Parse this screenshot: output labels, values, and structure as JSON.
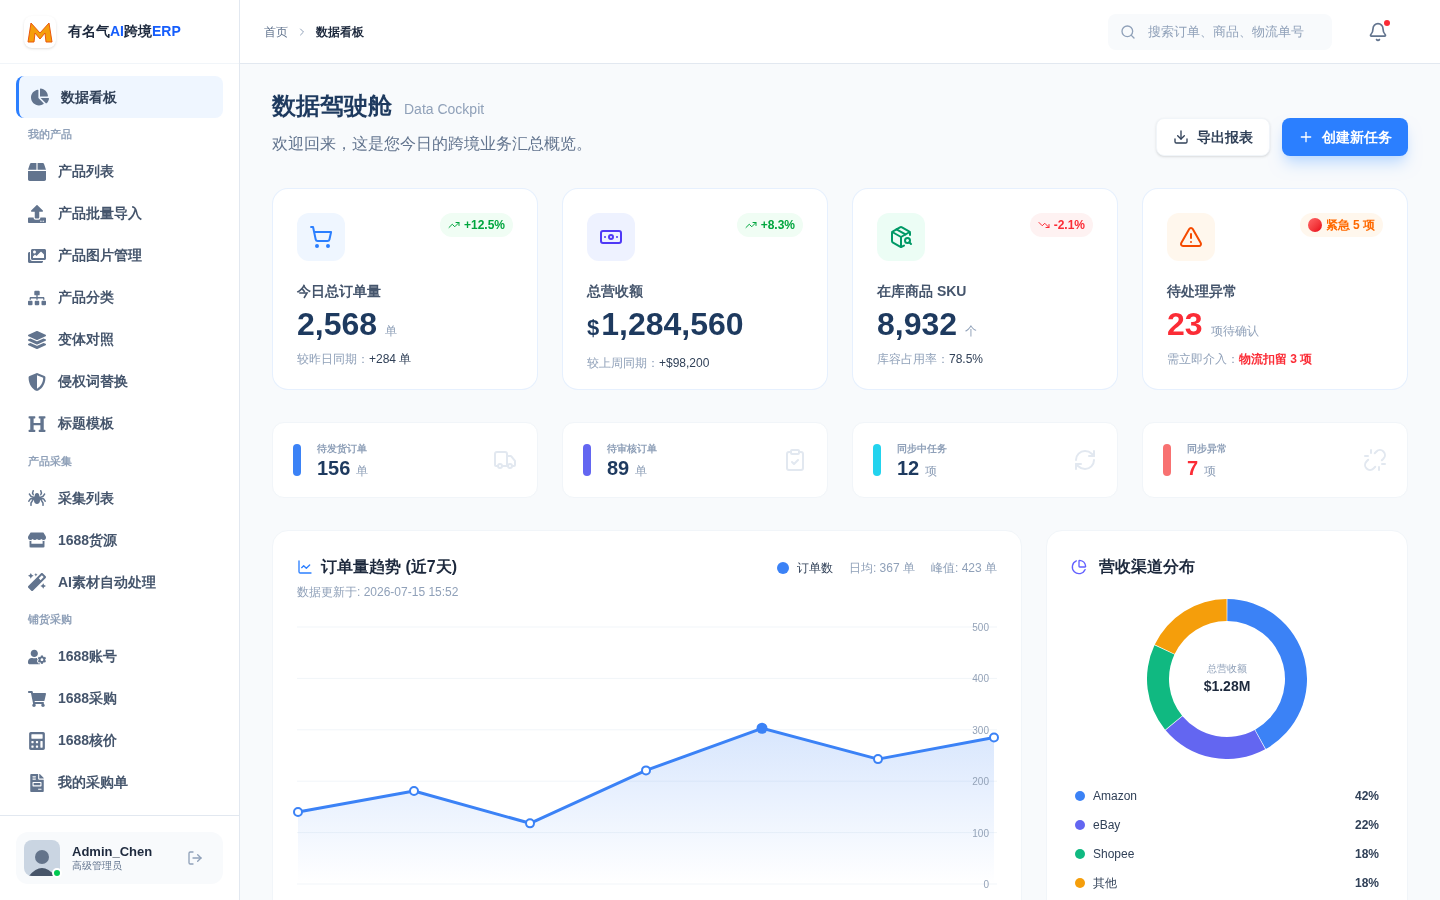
{
  "app": {
    "name": "有名气",
    "name_highlight": "AI",
    "name_middle": "跨境",
    "name_suffix": "ERP"
  },
  "sidebar": {
    "items": [
      {
        "kind": "item",
        "label": "数据看板",
        "selected": true
      },
      {
        "kind": "section",
        "label": "我的产品"
      },
      {
        "kind": "item",
        "label": "产品列表",
        "selected": false
      },
      {
        "kind": "item",
        "label": "产品批量导入",
        "selected": false
      },
      {
        "kind": "item",
        "label": "产品图片管理",
        "selected": false
      },
      {
        "kind": "item",
        "label": "产品分类",
        "selected": false
      },
      {
        "kind": "item",
        "label": "变体对照",
        "selected": false
      },
      {
        "kind": "item",
        "label": "侵权词替换",
        "selected": false
      },
      {
        "kind": "item",
        "label": "标题模板",
        "selected": false
      },
      {
        "kind": "section",
        "label": "产品采集"
      },
      {
        "kind": "item",
        "label": "采集列表",
        "selected": false
      },
      {
        "kind": "item",
        "label": "1688货源",
        "selected": false
      },
      {
        "kind": "item",
        "label": "AI素材自动处理",
        "selected": false
      },
      {
        "kind": "section",
        "label": "铺货采购"
      },
      {
        "kind": "item",
        "label": "1688账号",
        "selected": false
      },
      {
        "kind": "item",
        "label": "1688采购",
        "selected": false
      },
      {
        "kind": "item",
        "label": "1688核价",
        "selected": false
      },
      {
        "kind": "item",
        "label": "我的采购单",
        "selected": false
      }
    ],
    "user": {
      "name": "Admin_Chen",
      "role": "高级管理员",
      "online": true
    }
  },
  "header": {
    "breadcrumb": [
      "首页",
      "数据看板"
    ],
    "search": {
      "placeholder": "搜索订单、商品、物流单号"
    },
    "notification": true
  },
  "page": {
    "title": "数据驾驶舱",
    "subtitle_en": "Data Cockpit",
    "welcome": "欢迎回来，这是您今日的跨境业务汇总概览。",
    "buttons": [
      {
        "kind": "secondary",
        "label": "导出报表"
      },
      {
        "kind": "primary",
        "label": "创建新任务"
      }
    ]
  },
  "stats": [
    {
      "label": "今日总订单量",
      "value": "2,568",
      "unit": "单",
      "compare_label": "较昨日同期：",
      "compare_value": "+284 单",
      "badge": "+12.5%",
      "kind": "up",
      "alert": false
    },
    {
      "label": "总营收额",
      "prefix": "$",
      "value": "1,284,560",
      "compare_label": "较上周同期：",
      "compare_value": "+$98,200",
      "badge": "+8.3%",
      "kind": "up",
      "alert": false
    },
    {
      "label": "在库商品 SKU",
      "value": "8,932",
      "unit": "个",
      "compare_label": "库容占用率：",
      "compare_value": "78.5%",
      "badge": "-2.1%",
      "kind": "down",
      "alert": false
    },
    {
      "label": "待处理异常",
      "value": "23",
      "unit": "项待确认",
      "compare_label": "需立即介入：",
      "compare_value": "物流扣留 3 项",
      "badge": "紧急 5 项",
      "kind": "urgent",
      "alert": true
    }
  ],
  "queues": [
    {
      "label": "待发货订单",
      "value": "156",
      "unit": "单",
      "color": "#3b82f6",
      "alert": false
    },
    {
      "label": "待审核订单",
      "value": "89",
      "unit": "单",
      "color": "#6366f1",
      "alert": false
    },
    {
      "label": "同步中任务",
      "value": "12",
      "unit": "项",
      "color": "#22d3ee",
      "alert": false
    },
    {
      "label": "同步异常",
      "value": "7",
      "unit": "项",
      "color": "#f87171",
      "alert": true
    }
  ],
  "trend_card": {
    "title": "订单量趋势 (近7天)",
    "updated": "数据更新于: 2026-07-15 15:52",
    "average": "日均: 367 单",
    "peak": "峰值: 423 单",
    "chart_data": {
      "type": "area",
      "series": [
        {
          "name": "订单数",
          "color": "#3b82f6",
          "values": [
            140,
            181,
            118,
            221,
            303,
            243,
            285
          ]
        }
      ],
      "ylim": [
        0,
        500
      ],
      "yticks": [
        0,
        100,
        200,
        300,
        400,
        500
      ],
      "grid": true
    }
  },
  "channel_card": {
    "title": "营收渠道分布",
    "center_label": "总营收额",
    "center_value": "$1.28M",
    "chart_data": {
      "type": "donut",
      "categories": [
        "Amazon",
        "eBay",
        "Shopee",
        "其他"
      ],
      "values": [
        42,
        22,
        18,
        18
      ]
    },
    "legend": [
      {
        "value": "42%",
        "color": "#3b82f6"
      },
      {
        "value": "22%",
        "color": "#6366f1"
      },
      {
        "value": "18%",
        "color": "#10b981"
      },
      {
        "value": "18%",
        "color": "#f59e0b"
      }
    ]
  }
}
